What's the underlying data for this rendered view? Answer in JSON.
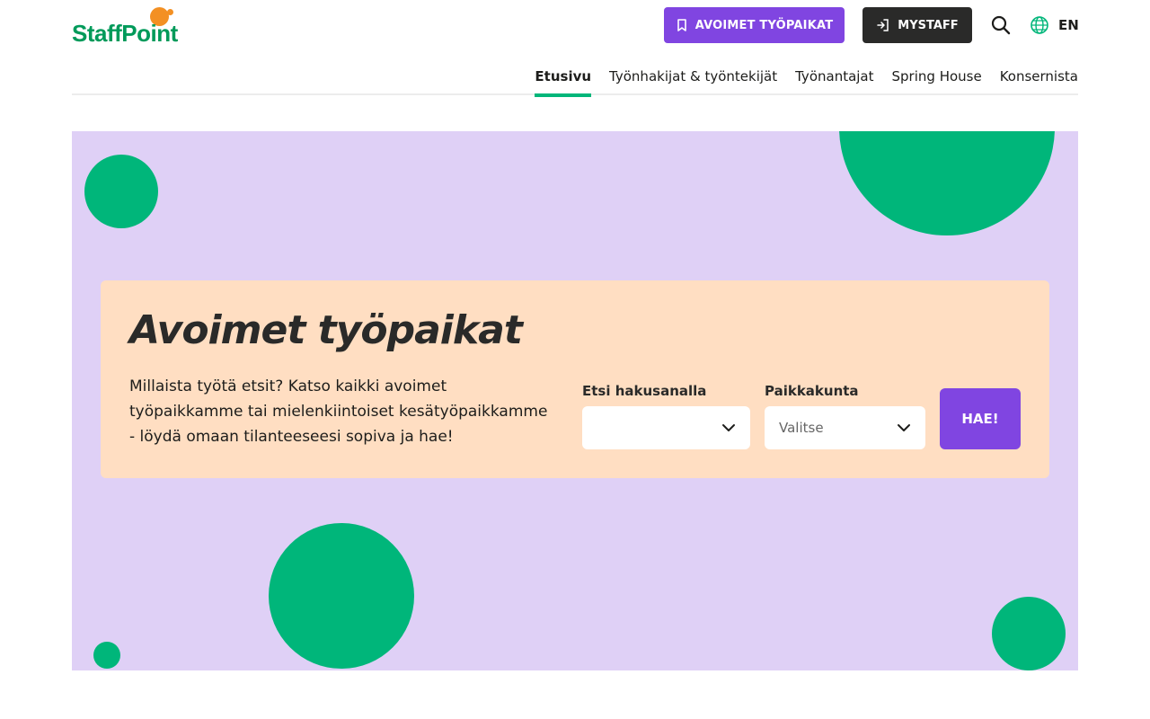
{
  "brand": {
    "logo_text": "StaffPoint",
    "accent_green": "#00b67a",
    "logo_orange": "#f39023",
    "purple": "#8045e1",
    "hero_bg": "#dfd0f6",
    "card_bg": "#ffdec2"
  },
  "header": {
    "jobs_button": {
      "label": "AVOIMET TYÖPAIKAT",
      "icon": "bookmark-icon"
    },
    "mystaff_button": {
      "label": "MYSTAFF",
      "icon": "login-icon"
    },
    "search_icon": "search-icon",
    "language": {
      "icon": "globe-icon",
      "label": "EN"
    }
  },
  "nav": {
    "items": [
      {
        "label": "Etusivu",
        "active": true
      },
      {
        "label": "Työnhakijat & työntekijät",
        "active": false
      },
      {
        "label": "Työnantajat",
        "active": false
      },
      {
        "label": "Spring House",
        "active": false
      },
      {
        "label": "Konsernista",
        "active": false
      }
    ]
  },
  "hero": {
    "title": "Avoimet työpaikat",
    "description": "Millaista työtä etsit? Katso kaikki avoimet työpaikkamme tai mielenkiintoiset kesätyöpaikkamme - löydä omaan tilanteeseesi sopiva ja hae!",
    "keyword_field": {
      "label": "Etsi hakusanalla",
      "value": ""
    },
    "location_field": {
      "label": "Paikkakunta",
      "value": "Valitse"
    },
    "submit_label": "HAE!"
  }
}
